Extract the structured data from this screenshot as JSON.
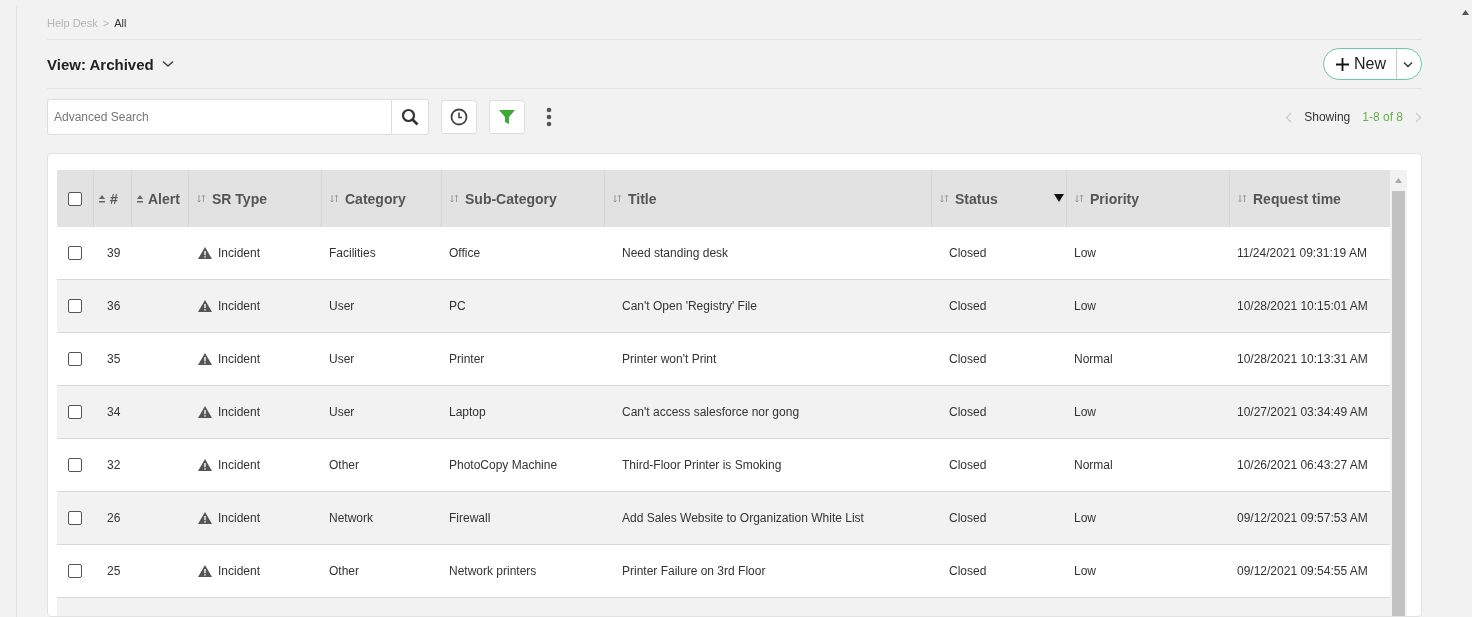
{
  "breadcrumb": {
    "parent": "Help Desk",
    "separator": ">",
    "current": "All"
  },
  "view": {
    "label": "View: Archived"
  },
  "new_button": {
    "label": "New"
  },
  "search": {
    "placeholder": "Advanced Search"
  },
  "pager": {
    "label": "Showing",
    "range": "1-8 of 8"
  },
  "table": {
    "select_all": {
      "checked": false
    },
    "columns": [
      {
        "label": "#",
        "sorted": true,
        "filtered": false
      },
      {
        "label": "Alert",
        "sorted": true,
        "filtered": false
      },
      {
        "label": "SR Type",
        "sorted": false,
        "filtered": false
      },
      {
        "label": "Category",
        "sorted": false,
        "filtered": false
      },
      {
        "label": "Sub-Category",
        "sorted": false,
        "filtered": false
      },
      {
        "label": "Title",
        "sorted": false,
        "filtered": false
      },
      {
        "label": "Status",
        "sorted": false,
        "filtered": true
      },
      {
        "label": "Priority",
        "sorted": false,
        "filtered": false
      },
      {
        "label": "Request time",
        "sorted": false,
        "filtered": false
      }
    ],
    "rows": [
      {
        "checked": false,
        "id": "39",
        "sr_type": "Incident",
        "category": "Facilities",
        "sub_category": "Office",
        "title": "Need standing desk",
        "status": "Closed",
        "priority": "Low",
        "request_time": "11/24/2021 09:31:19 AM"
      },
      {
        "checked": false,
        "id": "36",
        "sr_type": "Incident",
        "category": "User",
        "sub_category": "PC",
        "title": "Can't Open 'Registry' File",
        "status": "Closed",
        "priority": "Low",
        "request_time": "10/28/2021 10:15:01 AM"
      },
      {
        "checked": false,
        "id": "35",
        "sr_type": "Incident",
        "category": "User",
        "sub_category": "Printer",
        "title": "Printer won't Print",
        "status": "Closed",
        "priority": "Normal",
        "request_time": "10/28/2021 10:13:31 AM"
      },
      {
        "checked": false,
        "id": "34",
        "sr_type": "Incident",
        "category": "User",
        "sub_category": "Laptop",
        "title": "Can't access salesforce nor gong",
        "status": "Closed",
        "priority": "Low",
        "request_time": "10/27/2021 03:34:49 AM"
      },
      {
        "checked": false,
        "id": "32",
        "sr_type": "Incident",
        "category": "Other",
        "sub_category": "PhotoCopy Machine",
        "title": "Third-Floor Printer is Smoking",
        "status": "Closed",
        "priority": "Normal",
        "request_time": "10/26/2021 06:43:27 AM"
      },
      {
        "checked": false,
        "id": "26",
        "sr_type": "Incident",
        "category": "Network",
        "sub_category": "Firewall",
        "title": "Add Sales Website to Organization White List",
        "status": "Closed",
        "priority": "Low",
        "request_time": "09/12/2021 09:57:53 AM"
      },
      {
        "checked": false,
        "id": "25",
        "sr_type": "Incident",
        "category": "Other",
        "sub_category": "Network printers",
        "title": "Printer Failure on 3rd Floor",
        "status": "Closed",
        "priority": "Low",
        "request_time": "09/12/2021 09:54:55 AM"
      }
    ]
  }
}
